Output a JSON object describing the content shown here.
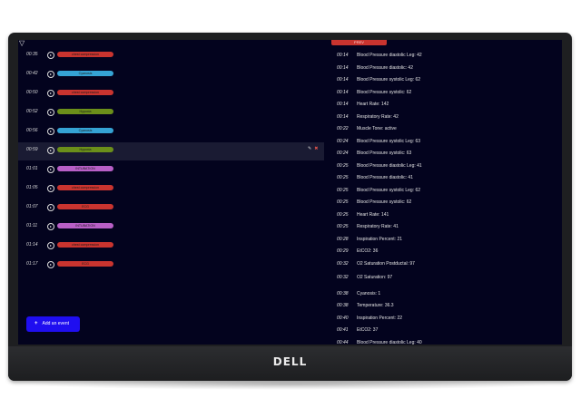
{
  "brand": {
    "logo": "DELL"
  },
  "app": {
    "add_button_label": "Add an event",
    "right_tab_label": "PREV",
    "colors": {
      "screen_bg": "#03031e",
      "accent": "#1f0ef0",
      "tab": "#c9342f",
      "red_pill": "#c9342f",
      "blue_pill": "#35a3d4",
      "green_pill": "#6b8f1a",
      "purple_pill": "#b85fc6"
    }
  },
  "events": [
    {
      "time": "00:35",
      "label": "chest compression",
      "color": "#c9342f"
    },
    {
      "time": "00:42",
      "label": "Cyanosis",
      "color": "#35a3d4"
    },
    {
      "time": "00:50",
      "label": "chest compression",
      "color": "#c9342f"
    },
    {
      "time": "00:52",
      "label": "Hypoxia",
      "color": "#6b8f1a"
    },
    {
      "time": "00:56",
      "label": "Cyanosis",
      "color": "#35a3d4"
    },
    {
      "time": "00:59",
      "label": "Hypoxia",
      "color": "#6b8f1a",
      "selected": true
    },
    {
      "time": "01:01",
      "label": "INTUBATION",
      "color": "#b85fc6"
    },
    {
      "time": "01:05",
      "label": "chest compression",
      "color": "#c9342f"
    },
    {
      "time": "01:07",
      "label": "ECG",
      "color": "#c9342f"
    },
    {
      "time": "01:11",
      "label": "INTUBATION",
      "color": "#b85fc6"
    },
    {
      "time": "01:14",
      "label": "chest compression",
      "color": "#c9342f"
    },
    {
      "time": "01:17",
      "label": "ECG",
      "color": "#c9342f"
    }
  ],
  "log": [
    {
      "time": "00:14",
      "label": "Blood Pressure diastolic Leg: 42"
    },
    {
      "time": "00:14",
      "label": "Blood Pressure diastolic: 42"
    },
    {
      "time": "00:14",
      "label": "Blood Pressure systolic Leg: 62"
    },
    {
      "time": "00:14",
      "label": "Blood Pressure systolic: 62"
    },
    {
      "time": "00:14",
      "label": "Heart Rate: 142"
    },
    {
      "time": "00:14",
      "label": "Respiratory Rate: 42"
    },
    {
      "time": "00:22",
      "label": "Muscle Tone: active"
    },
    {
      "time": "00:24",
      "label": "Blood Pressure systolic Leg: 63"
    },
    {
      "time": "00:24",
      "label": "Blood Pressure systolic: 63"
    },
    {
      "time": "00:25",
      "label": "Blood Pressure diastolic Leg: 41"
    },
    {
      "time": "00:25",
      "label": "Blood Pressure diastolic: 41"
    },
    {
      "time": "00:25",
      "label": "Blood Pressure systolic Leg: 62"
    },
    {
      "time": "00:25",
      "label": "Blood Pressure systolic: 62"
    },
    {
      "time": "00:25",
      "label": "Heart Rate: 141"
    },
    {
      "time": "00:25",
      "label": "Respiratory Rate: 41"
    },
    {
      "time": "00:28",
      "label": "Inspiration Percent: 21"
    },
    {
      "time": "00:29",
      "label": "EtCO2: 36"
    },
    {
      "time": "00:32",
      "label": "O2 Saturation Postductal: 97"
    },
    {
      "time": "00:32",
      "label": "O2 Saturation: 97"
    },
    {
      "time": "00:38",
      "label": "Cyanosis: 1"
    },
    {
      "time": "00:38",
      "label": "Temperature: 36.3"
    },
    {
      "time": "00:40",
      "label": "Inspiration Percent: 22"
    },
    {
      "time": "00:41",
      "label": "EtCO2: 37"
    },
    {
      "time": "00:44",
      "label": "Blood Pressure diastolic Leg: 40"
    }
  ]
}
